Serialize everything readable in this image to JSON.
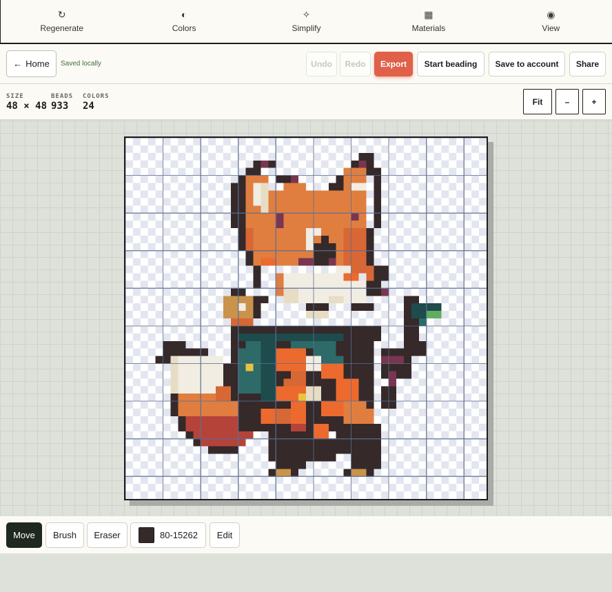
{
  "toolbar": {
    "items": [
      {
        "label": "Regenerate",
        "icon": "refresh-icon",
        "glyph": "↻"
      },
      {
        "label": "Colors",
        "icon": "contrast-icon",
        "glyph": "◐"
      },
      {
        "label": "Simplify",
        "icon": "sparkle-icon",
        "glyph": "✧"
      },
      {
        "label": "Materials",
        "icon": "grid-icon",
        "glyph": "▦"
      },
      {
        "label": "View",
        "icon": "eye-icon",
        "glyph": "◉"
      }
    ]
  },
  "actions": {
    "home_label": "Home",
    "home_arrow": "←",
    "saved_status": "Saved locally",
    "undo_label": "Undo",
    "redo_label": "Redo",
    "export_label": "Export",
    "start_beading_label": "Start beading",
    "save_account_label": "Save to account",
    "share_label": "Share"
  },
  "stats": {
    "size_label": "SIZE",
    "size_value": "48 × 48",
    "beads_label": "BEADS",
    "beads_value": "933",
    "colors_label": "COLORS",
    "colors_value": "24"
  },
  "zoom": {
    "fit_label": "Fit",
    "out_label": "–",
    "in_label": "+"
  },
  "pattern": {
    "grid_size": 48,
    "major_every": 5,
    "colors": {
      "outline": "#35292a",
      "orange": "#e07e40",
      "orange_dark": "#d86736",
      "orange_bright": "#ec6a2e",
      "rust": "#b5433a",
      "cream": "#f1ede3",
      "beige": "#e6ddc4",
      "teal": "#2d6a68",
      "teal_dark": "#1e4b4b",
      "maroon": "#7a3550",
      "tan": "#c9934c",
      "green": "#5fae5d",
      "yellow": "#e8c341"
    }
  },
  "bottom_tools": {
    "move_label": "Move",
    "brush_label": "Brush",
    "eraser_label": "Eraser",
    "color_code": "80-15262",
    "color_hex": "#35292a",
    "edit_label": "Edit"
  }
}
